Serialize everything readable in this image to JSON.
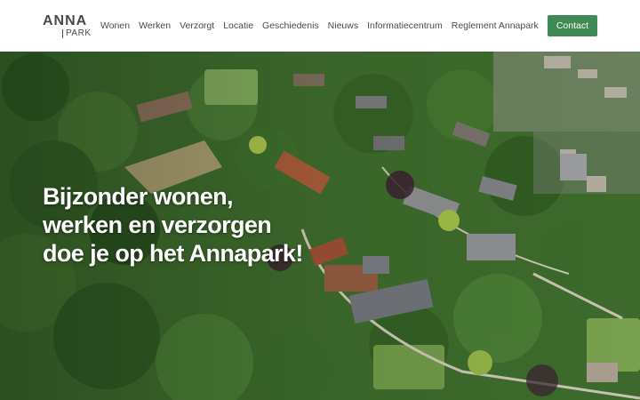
{
  "brand": {
    "logo_top": "ANNA",
    "logo_bottom": "PARK"
  },
  "nav": {
    "items": [
      "Wonen",
      "Werken",
      "Verzorgt",
      "Locatie",
      "Geschiedenis",
      "Nieuws",
      "Informatiecentrum",
      "Reglement Annapark"
    ],
    "contact_label": "Contact"
  },
  "hero": {
    "headline_lines": [
      "Bijzonder wonen,",
      "werken en verzorgen",
      "doe je op het Annapark!"
    ]
  },
  "colors": {
    "accent": "#3f8a54",
    "text": "#4a4a4a"
  }
}
